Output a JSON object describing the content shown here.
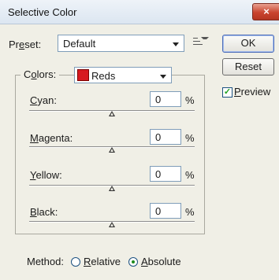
{
  "window": {
    "title": "Selective Color",
    "close_label": "×"
  },
  "preset": {
    "label_pre": "Pr",
    "label_u": "e",
    "label_post": "set:",
    "value": "Default"
  },
  "buttons": {
    "ok": "OK",
    "reset": "Reset"
  },
  "preview": {
    "label_u": "P",
    "label_rest": "review",
    "checked": true
  },
  "colors": {
    "label_pre": "C",
    "label_u": "o",
    "label_post": "lors:",
    "value": "Reds",
    "swatch_color": "#d71920"
  },
  "adjustments": [
    {
      "label_u": "C",
      "label_rest": "yan:",
      "value": "0",
      "unit": "%"
    },
    {
      "label_u": "M",
      "label_rest": "agenta:",
      "value": "0",
      "unit": "%"
    },
    {
      "label_u": "Y",
      "label_rest": "ellow:",
      "value": "0",
      "unit": "%"
    },
    {
      "label_u": "B",
      "label_rest": "lack:",
      "value": "0",
      "unit": "%"
    }
  ],
  "method": {
    "label": "Method:",
    "relative": {
      "label_u": "R",
      "label_rest": "elative",
      "selected": false
    },
    "absolute": {
      "label_u": "A",
      "label_rest": "bsolute",
      "selected": true
    }
  }
}
